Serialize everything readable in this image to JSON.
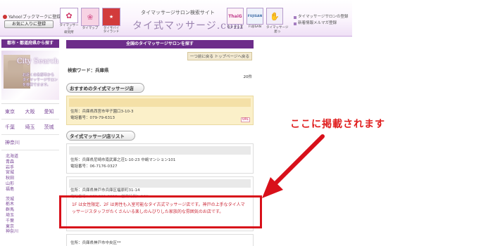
{
  "header": {
    "yahoo_text": "Yahoo!ブックマークに登録",
    "favorite_button": "お気に入りに登録",
    "site_tagline": "タイマッサージサロン検索サイト",
    "site_logo": "タイ式マッサージ.com",
    "icons": [
      {
        "name": "shield-icon",
        "caption": "タイマッサージ\n研究所",
        "glyph": "✿",
        "color": "#d23b6a"
      },
      {
        "name": "flower-icon",
        "caption": "タイマップ",
        "glyph": "❀",
        "color": "#d96a9a"
      },
      {
        "name": "thailand-icon",
        "caption": "タイサバイ\nタイランド",
        "glyph": "★",
        "color": "#d23b3b"
      }
    ],
    "right_icons": [
      {
        "name": "thai-goods-icon",
        "label": "ThaiG",
        "caption": "タイグッズ",
        "color": "#c0398a"
      },
      {
        "name": "fujisan-icon",
        "label": "FUJISAN",
        "caption": "FUJISAN",
        "color": "#3a6aa5"
      },
      {
        "name": "massage-icon",
        "label": "✋",
        "caption": "タイマッサージ\n屋っ",
        "color": "#7b5aa1"
      }
    ],
    "right_links": [
      "タイマッサージサロンの登録",
      "新着情報メルマガ登録"
    ]
  },
  "sidebar": {
    "heading": "都市・都道府県から探す",
    "search_brand": "City Search",
    "search_text": "お近くの各都市から\nタイマッサージサロン\nを検索できます。",
    "pref_rows": [
      [
        "東京",
        "大阪",
        "愛知"
      ],
      [
        "千葉",
        "埼玉",
        "茨城"
      ],
      [
        "神奈川",
        "",
        ""
      ]
    ],
    "pref_list_a": [
      "北海道",
      "青森",
      "岩手",
      "宮城",
      "秋田",
      "山形",
      "福島"
    ],
    "pref_list_b": [
      "茨城",
      "栃木",
      "群馬",
      "埼玉",
      "千葉",
      "東京",
      "神奈川"
    ]
  },
  "main": {
    "heading": "全国のタイマッサージサロンを探す",
    "nav": "一つ前に戻る トップページへ戻る",
    "keyword_label": "検索ワード：兵庫県",
    "count": "20件",
    "featured_label": "おすすめのタイ式マッサージ店",
    "featured": {
      "address": "住所：兵庫県西宮市甲子園口3-10-3",
      "phone": "電話番号：079-79-6313",
      "url_badge": "URL"
    },
    "list_label": "タイ式マッサージ店リスト",
    "shops": [
      {
        "address": "住所：兵庫県尼崎市南武庫之荘1-10-23 中嶋マンション101",
        "phone": "電話番号：06-7176-0327"
      },
      {
        "address": "住所：兵庫県神戸市兵庫区福原町31-14",
        "phone": "電話番号：078-591-0010　営業時間：24H",
        "desc": "1F は女性限定、2F は男性も入室可能なタイ古式マッサージ店です。神戸の上手なタイ人マッサージスタッフがたくさんいる楽しのんびりした家族的な雰囲気のお店です。"
      },
      {
        "address": "住所：兵庫県神戸市中央区**",
        "phone": ""
      }
    ]
  },
  "overlay": {
    "callout": "ここに掲載されます",
    "box_color": "#d8101a"
  }
}
